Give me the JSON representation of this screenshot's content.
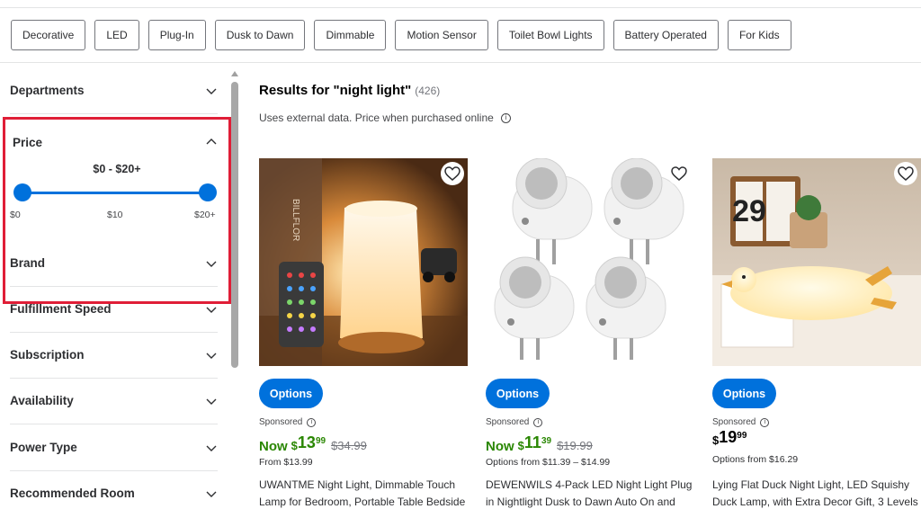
{
  "chips": [
    "Decorative",
    "LED",
    "Plug-In",
    "Dusk to Dawn",
    "Dimmable",
    "Motion Sensor",
    "Toilet Bowl Lights",
    "Battery Operated",
    "For Kids"
  ],
  "sidebar": {
    "departments": "Departments",
    "price": {
      "title": "Price",
      "range": "$0 - $20+",
      "ticks": [
        "$0",
        "$10",
        "$20+"
      ],
      "slider_min_fraction": 0,
      "slider_max_fraction": 1
    },
    "facets": [
      "Brand",
      "Fulfillment Speed",
      "Subscription",
      "Availability",
      "Power Type",
      "Recommended Room"
    ]
  },
  "results": {
    "title": "Results for \"night light\"",
    "count": "(426)",
    "external_note": "Uses external data. Price when purchased online"
  },
  "products": [
    {
      "options_label": "Options",
      "sponsored": "Sponsored",
      "now_label": "Now",
      "price_dollars": "13",
      "price_cents": "99",
      "was_price": "$34.99",
      "from_text": "From $13.99",
      "title": "UWANTME Night Light, Dimmable Touch Lamp for Bedroom, Portable Table Bedside"
    },
    {
      "options_label": "Options",
      "sponsored": "Sponsored",
      "now_label": "Now",
      "price_dollars": "11",
      "price_cents": "39",
      "was_price": "$19.99",
      "from_text": "Options from $11.39 – $14.99",
      "title": "DEWENWILS 4-Pack LED Night Light Plug in Nightlight Dusk to Dawn Auto On and"
    },
    {
      "options_label": "Options",
      "sponsored": "Sponsored",
      "now_label": "",
      "price_dollars": "19",
      "price_cents": "99",
      "was_price": "",
      "from_text": "Options from $16.29",
      "title": "Lying Flat Duck Night Light, LED Squishy Duck Lamp, with Extra Decor Gift, 3 Levels"
    }
  ],
  "image_text": {
    "calendar_day": "29",
    "box_brand": "BILLFLOR"
  },
  "colors": {
    "accent_blue": "#0071dc",
    "sale_green": "#2a8703",
    "highlight_red": "#e01e37"
  }
}
